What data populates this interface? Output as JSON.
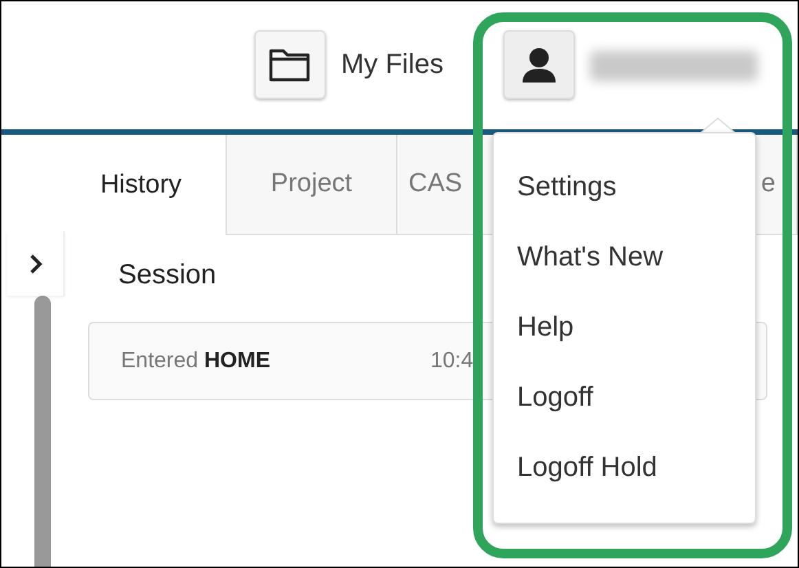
{
  "header": {
    "files_button": {
      "label": "My Files"
    }
  },
  "tabs": [
    {
      "label": "History",
      "selected": true
    },
    {
      "label": "Project",
      "selected": false
    },
    {
      "label": "CAS",
      "selected": false
    },
    {
      "label": "e",
      "selected": false
    }
  ],
  "session": {
    "heading": "Session",
    "entries": [
      {
        "text": "Entered **HOME**",
        "time": "10:4"
      }
    ]
  },
  "user_menu": {
    "items": [
      "Settings",
      "What's New",
      "Help",
      "Logoff",
      "Logoff Hold"
    ]
  }
}
